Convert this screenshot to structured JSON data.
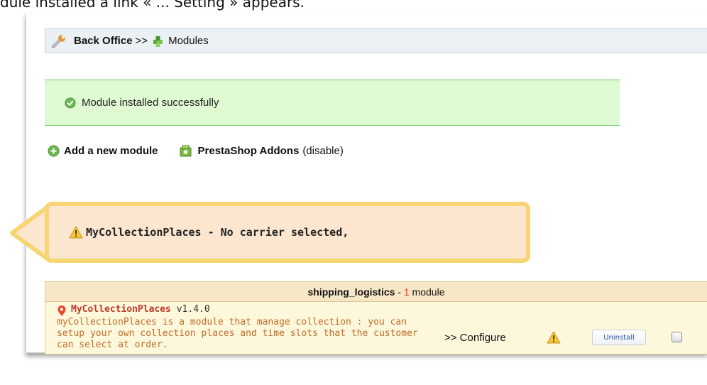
{
  "caption": {
    "text": "dule installed a link « ... Setting » appears."
  },
  "breadcrumb": {
    "back_office": "Back Office",
    "separator": ">>",
    "current": "Modules"
  },
  "success": {
    "message": "Module installed successfully"
  },
  "actions": {
    "add_module": "Add a new module",
    "addons": "PrestaShop Addons",
    "addons_toggle": "(disable)"
  },
  "warning": {
    "message": "MyCollectionPlaces - No carrier selected,"
  },
  "section": {
    "name": "shipping_logistics",
    "dash": " - ",
    "count": "1",
    "count_label": " module"
  },
  "module": {
    "name": "MyCollectionPlaces",
    "version": "v1.4.0",
    "description": "myCollectionPlaces is a module that manage collection : you can setup your own collection places and time slots that the customer can select at order.",
    "configure": ">> Configure",
    "uninstall": "Uninstall"
  },
  "colors": {
    "success_bg": "#dffad3",
    "warning_bg": "#fde6d0",
    "callout_border": "#f6d572",
    "section_bg": "#f7e7c6",
    "module_bg": "#fdf8dc",
    "module_name": "#c0392b",
    "count": "#e32b2b"
  },
  "icons": [
    "wrench-icon",
    "puzzle-icon",
    "check-icon",
    "add-icon",
    "addons-icon",
    "warning-icon",
    "pin-icon"
  ]
}
